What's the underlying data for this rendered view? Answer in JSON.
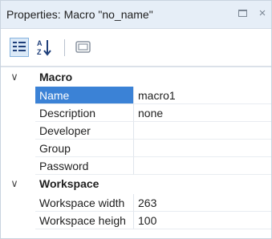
{
  "window": {
    "title": "Properties: Macro \"no_name\"",
    "maximize_glyph": "",
    "close_glyph": "×"
  },
  "toolbar": {
    "buttons": [
      {
        "name": "categorized-view-icon",
        "active": true
      },
      {
        "name": "sort-alphabetical-icon",
        "active": false
      },
      {
        "name": "property-pages-icon",
        "active": false
      }
    ]
  },
  "categories": [
    {
      "label": "Macro",
      "toggle": "∨",
      "properties": [
        {
          "name": "Name",
          "value": "macro1",
          "selected": true
        },
        {
          "name": "Description",
          "value": "none"
        },
        {
          "name": "Developer",
          "value": ""
        },
        {
          "name": "Group",
          "value": ""
        },
        {
          "name": "Password",
          "value": ""
        }
      ]
    },
    {
      "label": "Workspace",
      "toggle": "∨",
      "properties": [
        {
          "name": "Workspace width",
          "value": "263"
        },
        {
          "name": "Workspace heigh",
          "value": "100"
        }
      ]
    }
  ],
  "colors": {
    "title_bg": "#e6eef7",
    "selection": "#3b82d6",
    "active_button_bg": "#dbe9f7"
  }
}
